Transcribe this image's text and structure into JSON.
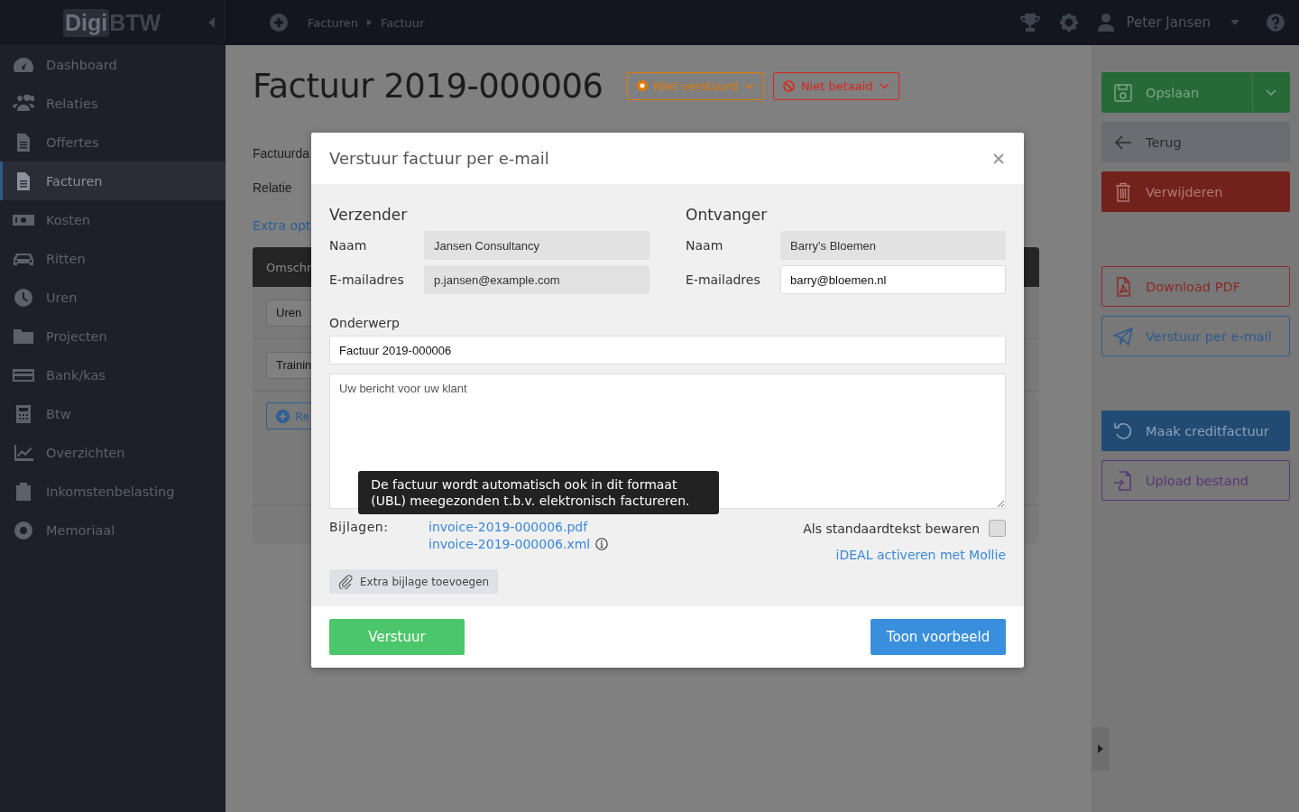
{
  "top_bar": {
    "logo": {
      "part_1": "Digi",
      "part_2": "BTW"
    },
    "breadcrumbs": [
      "Facturen",
      "Factuur"
    ],
    "user": "Peter Jansen"
  },
  "sidebar": {
    "items": [
      {
        "label": "Dashboard",
        "selected": false
      },
      {
        "label": "Relaties",
        "selected": false
      },
      {
        "label": "Offertes",
        "selected": false
      },
      {
        "label": "Facturen",
        "selected": true
      },
      {
        "label": "Kosten",
        "selected": false
      },
      {
        "label": "Ritten",
        "selected": false
      },
      {
        "label": "Uren",
        "selected": false
      },
      {
        "label": "Projecten",
        "selected": false
      },
      {
        "label": "Bank/kas",
        "selected": false
      },
      {
        "label": "Btw",
        "selected": false
      },
      {
        "label": "Overzichten",
        "selected": false
      },
      {
        "label": "Inkomstenbelasting",
        "selected": false
      },
      {
        "label": "Memoriaal",
        "selected": false
      }
    ]
  },
  "invoice": {
    "title": "Factuur 2019-000006",
    "status_buttons": [
      {
        "label": "Niet verstuurd",
        "kind": "dot",
        "color": "#e07b00"
      },
      {
        "label": "Niet betaald",
        "kind": "ban",
        "color": "#d9261c"
      }
    ],
    "fields": [
      "Factuurda",
      "Relatie"
    ],
    "extra_link": "Extra opt",
    "table": {
      "column_1": "Omschr",
      "rows": [
        "Uren",
        "Trainin"
      ]
    },
    "add_button": "Re"
  },
  "actions": [
    {
      "label": "Opslaan",
      "kind": "save"
    },
    {
      "label": "Terug",
      "kind": "back"
    },
    {
      "label": "Verwijderen",
      "kind": "delete"
    },
    {
      "label": "Download PDF",
      "kind": "pdf"
    },
    {
      "label": "Verstuur per e-mail",
      "kind": "email"
    },
    {
      "label": "Maak creditfactuur",
      "kind": "credit"
    },
    {
      "label": "Upload bestand",
      "kind": "upload"
    }
  ],
  "modal": {
    "title": "Verstuur factuur per e-mail",
    "sender": {
      "heading": "Verzender",
      "fields": [
        {
          "label": "Naam",
          "value": "Jansen Consultancy",
          "disabled": true
        },
        {
          "label": "E-mailadres",
          "value": "p.jansen@example.com",
          "disabled": true
        }
      ]
    },
    "recipient": {
      "heading": "Ontvanger",
      "fields": [
        {
          "label": "Naam",
          "value": "Barry's Bloemen",
          "disabled": true
        },
        {
          "label": "E-mailadres",
          "value": "barry@bloemen.nl",
          "disabled": false
        }
      ]
    },
    "subject": {
      "label": "Onderwerp",
      "value": "Factuur 2019-000006"
    },
    "message": {
      "placeholder": "Uw bericht voor uw klant"
    },
    "attachments": {
      "label": "Bijlagen:",
      "files": [
        "invoice-2019-000006.pdf",
        "invoice-2019-000006.xml"
      ],
      "tooltip": "De factuur wordt automatisch ook in dit formaat (UBL) meegezonden t.b.v. elektronisch factureren.",
      "add_button": "Extra bijlage toevoegen"
    },
    "save_default": {
      "label": "Als standaardtekst bewaren",
      "checked": false
    },
    "mollie_link": "iDEAL activeren met Mollie",
    "send_button": "Verstuur",
    "preview_button": "Toon voorbeeld"
  }
}
